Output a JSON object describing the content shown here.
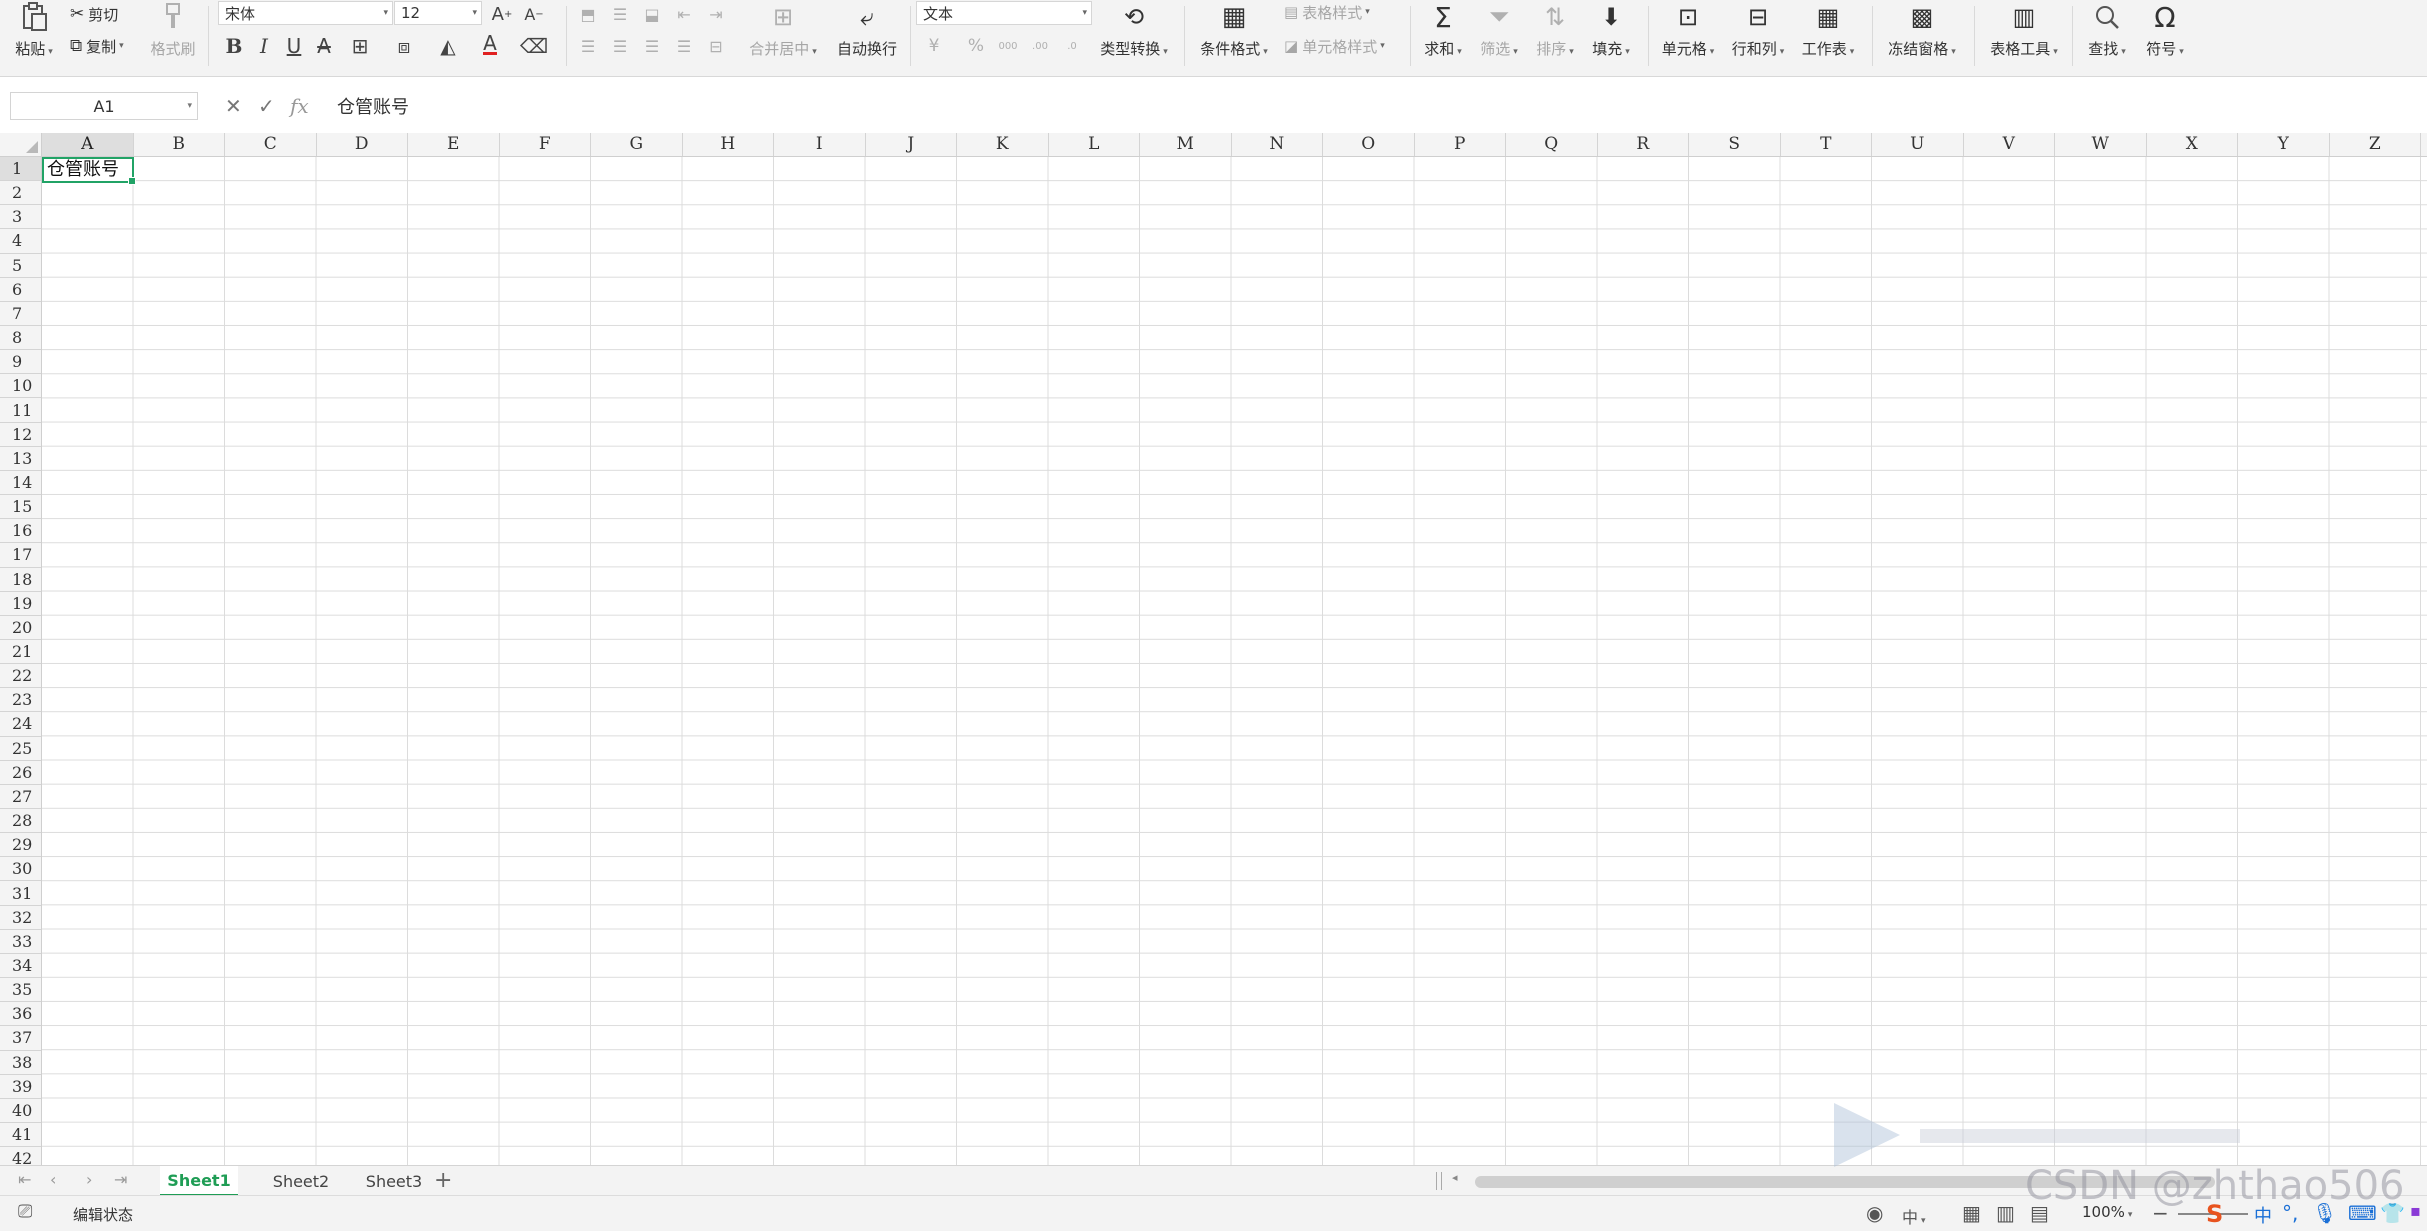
{
  "ribbon": {
    "paste": "粘贴",
    "cut": "剪切",
    "copy": "复制",
    "format_painter": "格式刷",
    "font_name": "宋体",
    "font_size": "12",
    "merge_center": "合并居中",
    "auto_wrap": "自动换行",
    "number_format": "文本",
    "type_convert": "类型转换",
    "conditional_format": "条件格式",
    "table_style": "表格样式",
    "cell_style": "单元格样式",
    "sum": "求和",
    "filter": "筛选",
    "sort": "排序",
    "fill": "填充",
    "cell": "单元格",
    "row_col": "行和列",
    "worksheet": "工作表",
    "freeze": "冻结窗格",
    "table_tools": "表格工具",
    "find": "查找",
    "symbol": "符号"
  },
  "formula_bar": {
    "name_box": "A1",
    "value": "仓管账号"
  },
  "grid": {
    "columns": [
      "A",
      "B",
      "C",
      "D",
      "E",
      "F",
      "G",
      "H",
      "I",
      "J",
      "K",
      "L",
      "M",
      "N",
      "O",
      "P",
      "Q",
      "R",
      "S",
      "T",
      "U",
      "V",
      "W",
      "X",
      "Y",
      "Z"
    ],
    "rows": [
      "1",
      "2",
      "3",
      "4",
      "5",
      "6",
      "7",
      "8",
      "9",
      "10",
      "11",
      "12",
      "13",
      "14",
      "15",
      "16",
      "17",
      "18",
      "19",
      "20",
      "21",
      "22",
      "23",
      "24",
      "25",
      "26",
      "27",
      "28",
      "29",
      "30",
      "31",
      "32",
      "33",
      "34",
      "35",
      "36",
      "37",
      "38",
      "39",
      "40",
      "41",
      "42"
    ],
    "active_cell": "A1",
    "a1_value": "仓管账号"
  },
  "sheets": [
    "Sheet1",
    "Sheet2",
    "Sheet3"
  ],
  "active_sheet": "Sheet1",
  "status": {
    "mode": "编辑状态",
    "zoom": "100%",
    "ime_label": "中"
  },
  "watermark": "CSDN @zhthao506",
  "colors": {
    "accent": "#21a366",
    "active_tab": "#1f9d55",
    "font_color_bar": "#e02020"
  }
}
